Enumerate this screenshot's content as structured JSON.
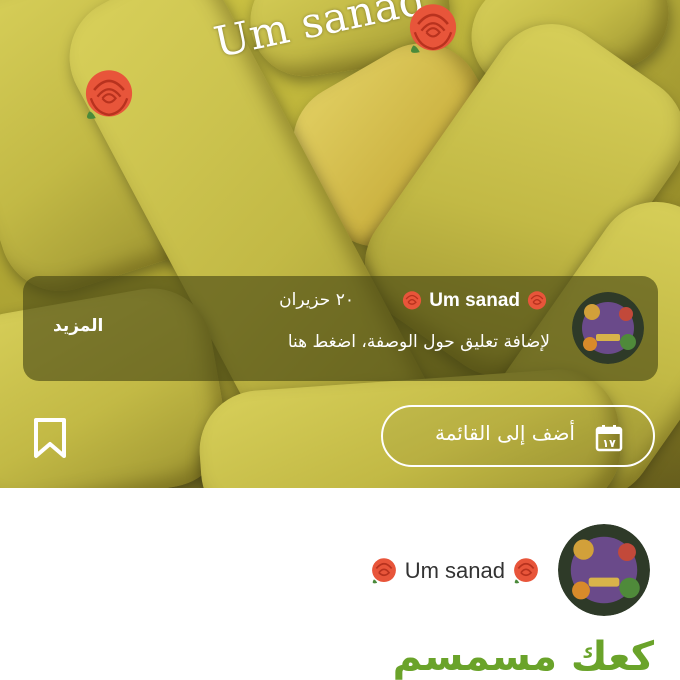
{
  "hero": {
    "watermark_text": "Um sanad",
    "bookmark_icon": "bookmark-icon"
  },
  "comment_card": {
    "author_name": "Um sanad",
    "date": "٢٠ حزيران",
    "prompt": "لإضافة تعليق حول الوصفة، اضغط هنا",
    "more_label": "المزيد"
  },
  "add_to_list": {
    "label": "أضف إلى القائمة",
    "icon": "calendar-icon"
  },
  "author": {
    "name": "Um sanad"
  },
  "recipe": {
    "title": "كعك مسمسم"
  },
  "colors": {
    "title_green": "#6aa32a",
    "rose": "#e8553a"
  }
}
